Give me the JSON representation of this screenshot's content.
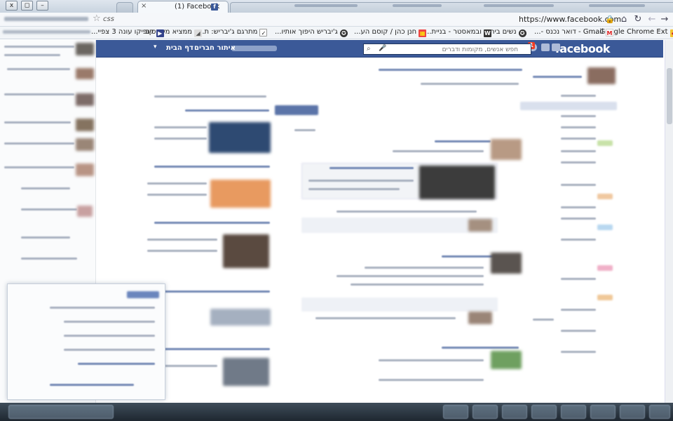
{
  "browser": {
    "window_controls": [
      "x",
      "◻",
      "–"
    ],
    "active_tab": {
      "title": "(1) Facebook",
      "close": "×"
    },
    "url": "https://www.facebook.com",
    "omnibox_secondary": "css",
    "bookmarks": [
      "Google Chrome Ext...",
      "Gmail - דואר נכנס -...",
      "נשים בירוק",
      "ובמאסטר - בניית...",
      "חנן כהן / קוסם הע...",
      "ג'יבריש היפוך אותיו...",
      "מתרגם ג'יבריש: ת...",
      "ממציא משפטים",
      "קופיקו עונה 3 צפיי..."
    ]
  },
  "facebook": {
    "logo": "facebook",
    "search_placeholder": "חפש אנשים, מקומות ודברים",
    "notifications_count": "1",
    "nav_home": "דף הבית",
    "nav_find_friends": "איתור חברים"
  },
  "colors": {
    "facebook_blue": "#3b5998",
    "chrome_frame": "#c8d3df",
    "badge_red": "#f03d25",
    "taskbar": "#1e2730"
  }
}
